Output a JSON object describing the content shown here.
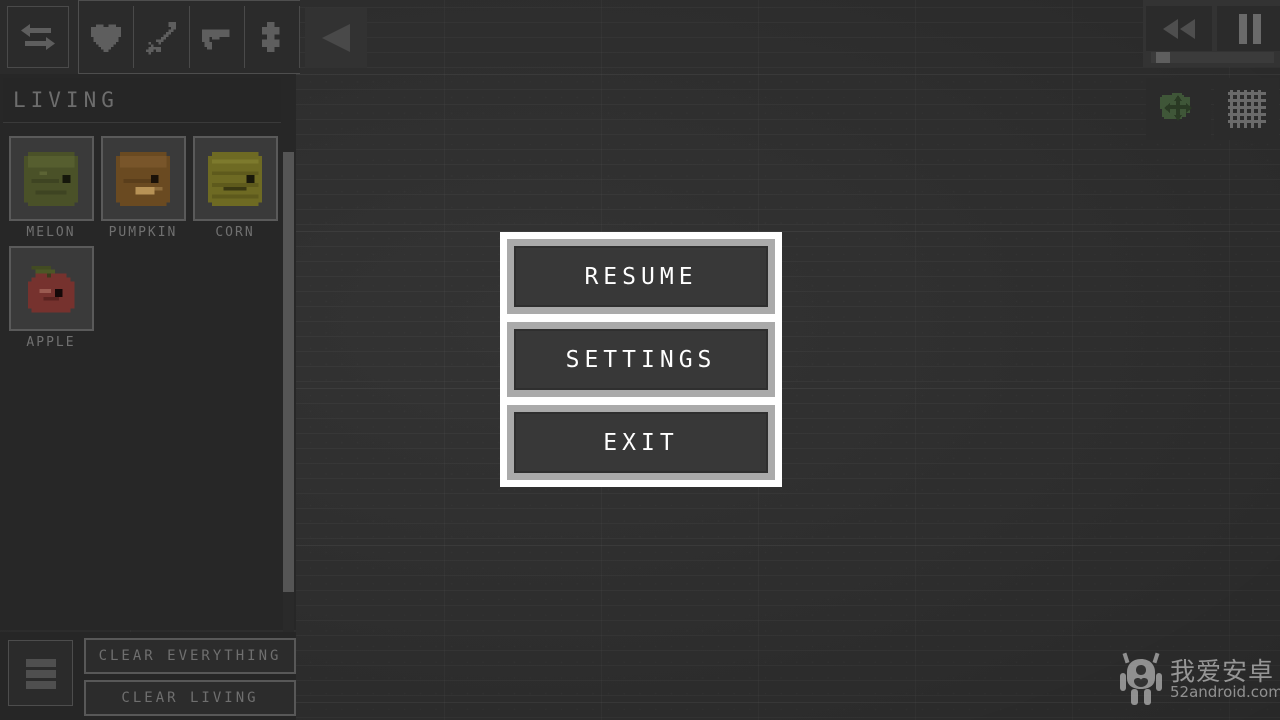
{
  "app": {
    "background_color": "#313131",
    "accent_color": "#ffffff"
  },
  "toolbar": {
    "swap_tab": {
      "label": "",
      "icon": "swap-arrows-icon"
    },
    "tabs": [
      {
        "icon": "heart-icon",
        "name": "living"
      },
      {
        "icon": "sword-icon",
        "name": "melee"
      },
      {
        "icon": "gun-icon",
        "name": "guns"
      },
      {
        "icon": "partial-icon",
        "name": "more"
      }
    ],
    "back_button": {
      "icon": "back-triangle-icon"
    }
  },
  "palette": {
    "title": "LIVING",
    "items": [
      {
        "label": "MELON",
        "sprite": "melon-sprite",
        "color": "#4b5129"
      },
      {
        "label": "PUMPKIN",
        "sprite": "pumpkin-sprite",
        "color": "#6b4a20"
      },
      {
        "label": "CORN",
        "sprite": "corn-sprite",
        "color": "#6f6b22"
      },
      {
        "label": "APPLE",
        "sprite": "apple-sprite",
        "color": "#7a3430"
      }
    ],
    "scrollbar": {
      "name": "palette-scrollbar"
    }
  },
  "bottom_bar": {
    "menu_button": {
      "icon": "hamburger-menu-icon"
    },
    "clear_everything_label": "CLEAR EVERYTHING",
    "clear_living_label": "CLEAR LIVING"
  },
  "playback": {
    "rewind_button": {
      "icon": "rewind-icon"
    },
    "pause_button": {
      "icon": "pause-icon"
    },
    "speed_slider": {
      "name": "speed-slider",
      "value_percent": 5
    }
  },
  "right_tools": [
    {
      "name": "move-tool",
      "icon": "creature-move-icon"
    },
    {
      "name": "grid-tool",
      "icon": "grid-icon"
    }
  ],
  "pause_menu": {
    "buttons": [
      {
        "label": "RESUME"
      },
      {
        "label": "SETTINGS"
      },
      {
        "label": "EXIT"
      }
    ]
  },
  "watermark": {
    "cn": "我爱安卓",
    "en": "52android.com",
    "icon": "android-robot-icon"
  }
}
